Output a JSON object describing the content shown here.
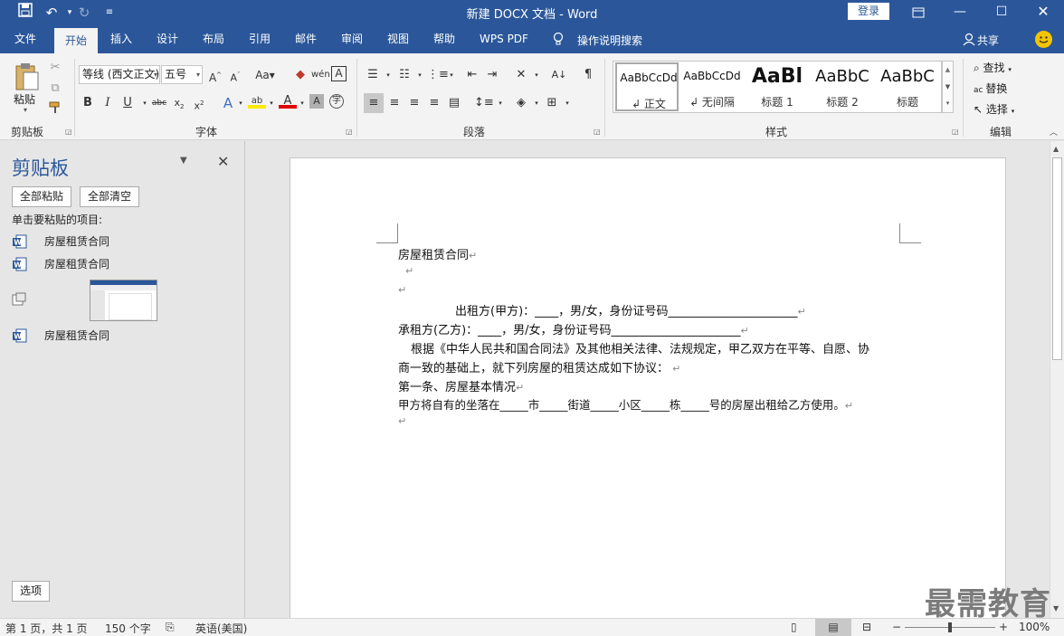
{
  "window": {
    "title": "新建 DOCX 文档 - Word",
    "login_label": "登录"
  },
  "tabs": [
    {
      "label": "文件"
    },
    {
      "label": "开始"
    },
    {
      "label": "插入"
    },
    {
      "label": "设计"
    },
    {
      "label": "布局"
    },
    {
      "label": "引用"
    },
    {
      "label": "邮件"
    },
    {
      "label": "审阅"
    },
    {
      "label": "视图"
    },
    {
      "label": "帮助"
    },
    {
      "label": "WPS PDF"
    }
  ],
  "tell_me": "操作说明搜索",
  "share_label": "共享",
  "ribbon": {
    "groups": {
      "clipboard": "剪贴板",
      "font": "字体",
      "paragraph": "段落",
      "styles": "样式",
      "editing": "编辑"
    },
    "paste_label": "粘贴",
    "font_name": "等线 (西文正文)",
    "font_size": "五号",
    "styles": [
      {
        "sample": "AaBbCcDd",
        "name": "↲ 正文"
      },
      {
        "sample": "AaBbCcDd",
        "name": "↲ 无间隔"
      },
      {
        "sample": "AaBl",
        "name": "标题 1"
      },
      {
        "sample": "AaBbC",
        "name": "标题 2"
      },
      {
        "sample": "AaBbC",
        "name": "标题"
      }
    ],
    "editing": {
      "find": "查找",
      "replace": "替换",
      "select": "选择"
    }
  },
  "clipboard_pane": {
    "title": "剪贴板",
    "paste_all": "全部粘贴",
    "clear_all": "全部清空",
    "hint": "单击要粘贴的项目:",
    "items": [
      "房屋租赁合同",
      "房屋租赁合同",
      "房屋租赁合同"
    ],
    "options": "选项"
  },
  "document": {
    "lines": [
      "房屋租赁合同",
      "",
      "",
      "出租方(甲方)：____，男/女，身份证号码______________________",
      "承租方(乙方)：____，男/女，身份证号码______________________",
      "根据《中华人民共和国合同法》及其他相关法律、法规规定，甲乙双方在平等、自愿、协",
      "商一致的基础上，就下列房屋的租赁达成如下协议：",
      "第一条、房屋基本情况",
      "甲方将自有的坐落在_____市_____街道_____小区_____栋_____号的房屋出租给乙方使用。",
      ""
    ]
  },
  "status": {
    "page": "第 1 页，共 1 页",
    "words": "150 个字",
    "language": "英语(美国)",
    "zoom": "100%"
  },
  "watermark": "最需教育",
  "colors": {
    "accent": "#2b579a"
  }
}
